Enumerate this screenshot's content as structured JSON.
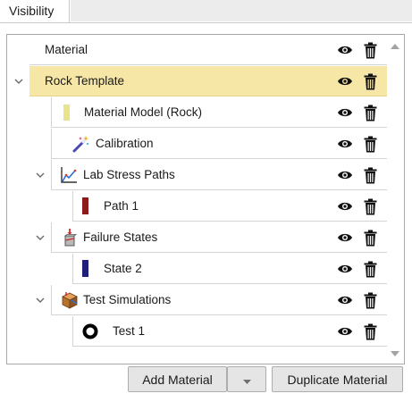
{
  "tab": {
    "label": "Visibility"
  },
  "tree": {
    "rows": [
      {
        "label": "Material",
        "icon": "none"
      },
      {
        "label": "Rock Template",
        "icon": "none",
        "selected": true
      },
      {
        "label": "Material Model (Rock)",
        "icon": "color-swatch",
        "color": "#e9e48a"
      },
      {
        "label": "Calibration",
        "icon": "magic-wand-icon"
      },
      {
        "label": "Lab Stress Paths",
        "icon": "stress-path-chart-icon"
      },
      {
        "label": "Path 1",
        "icon": "color-swatch",
        "color": "#8b1a1a"
      },
      {
        "label": "Failure States",
        "icon": "failure-state-icon"
      },
      {
        "label": "State 2",
        "icon": "color-swatch",
        "color": "#1f1f7a"
      },
      {
        "label": "Test Simulations",
        "icon": "test-simulation-icon"
      },
      {
        "label": "Test 1",
        "icon": "ring-marker-icon"
      }
    ]
  },
  "buttons": {
    "add_material": "Add Material",
    "duplicate_material": "Duplicate Material"
  }
}
